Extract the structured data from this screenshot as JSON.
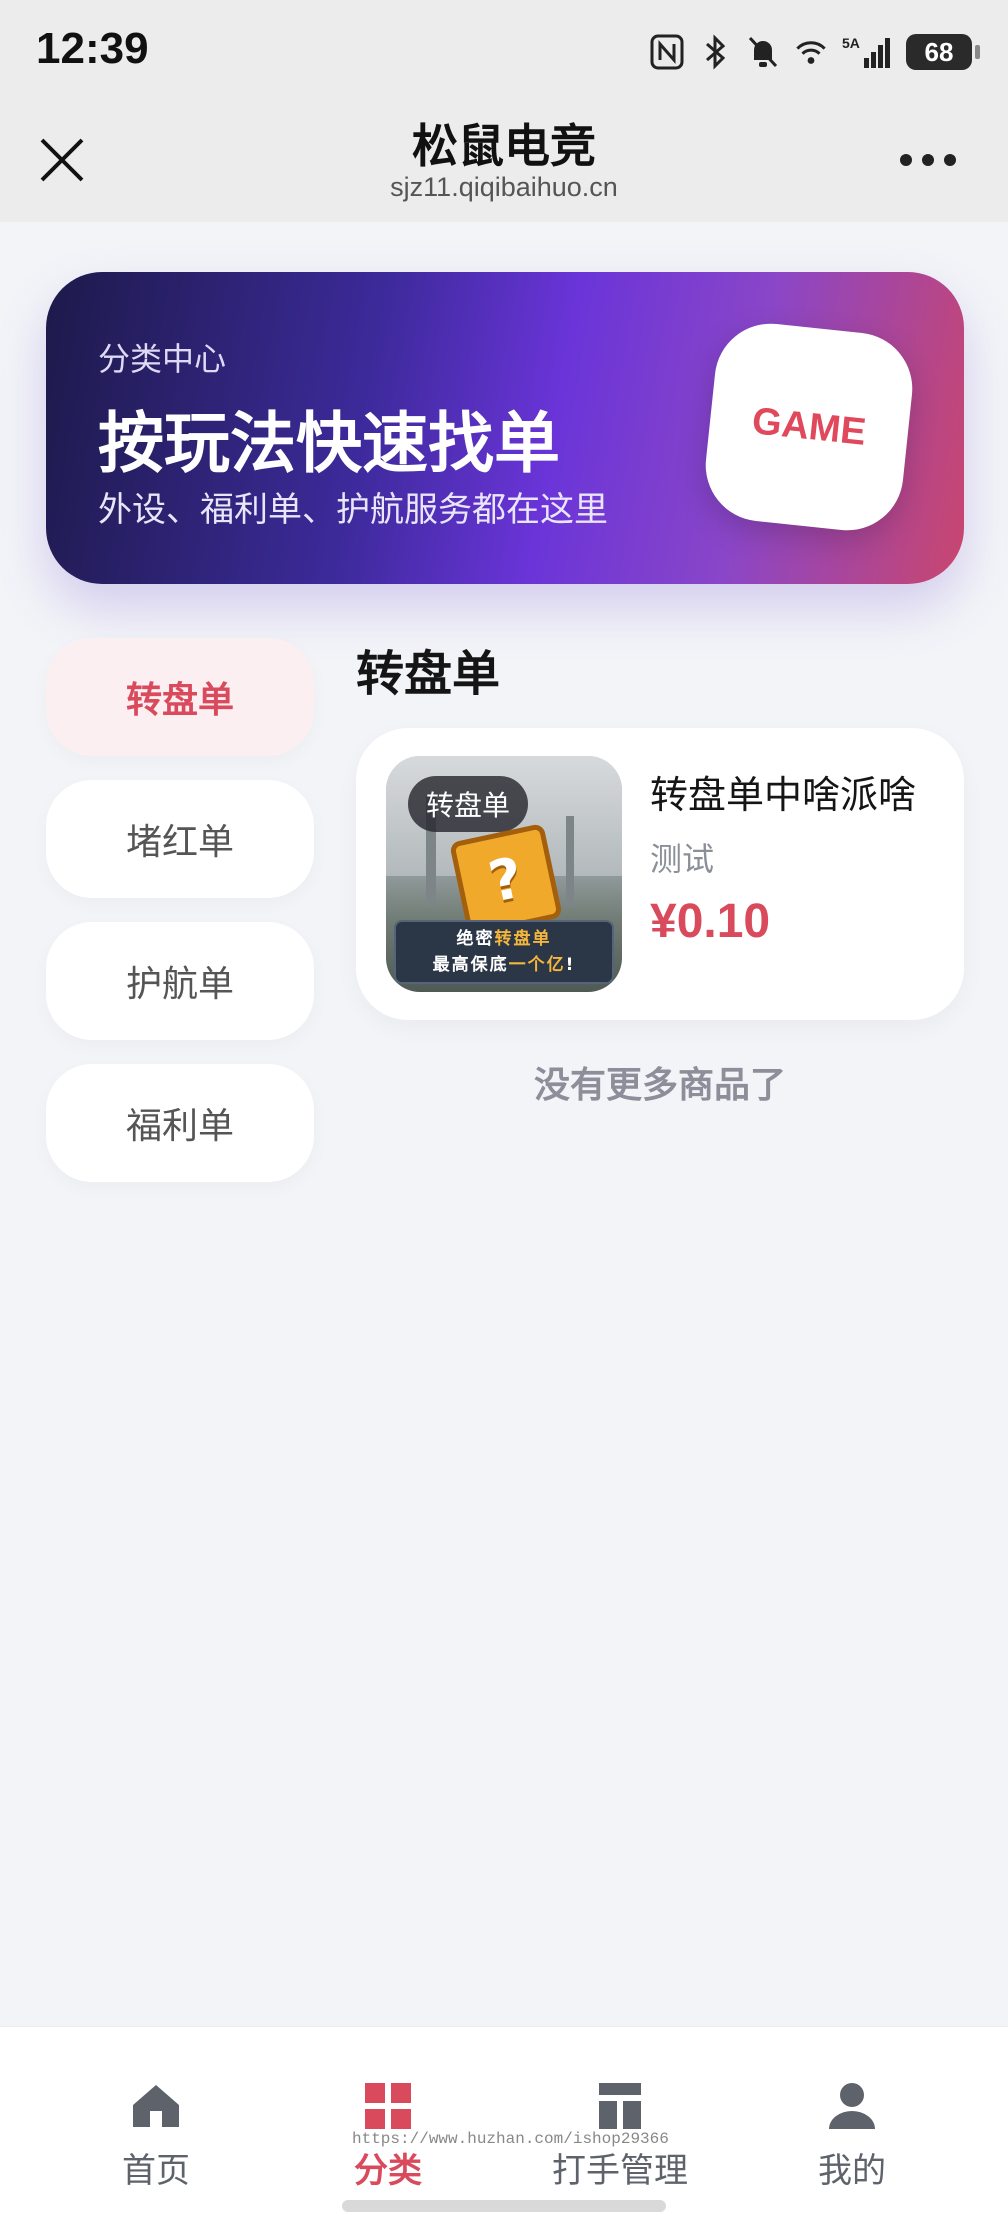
{
  "status_bar": {
    "time": "12:39",
    "battery": "68",
    "network": "5A"
  },
  "header": {
    "title": "松鼠电竞",
    "subtitle": "sjz11.qiqibaihuo.cn",
    "close_icon": "close-icon",
    "more_icon": "more-icon"
  },
  "banner": {
    "label": "分类中心",
    "title": "按玩法快速找单",
    "description": "外设、福利单、护航服务都在这里",
    "badge": "GAME"
  },
  "categories": [
    {
      "label": "转盘单",
      "active": true
    },
    {
      "label": "堵红单",
      "active": false
    },
    {
      "label": "护航单",
      "active": false
    },
    {
      "label": "福利单",
      "active": false
    }
  ],
  "section": {
    "title": "转盘单"
  },
  "products": [
    {
      "name": "转盘单中啥派啥",
      "subtitle": "测试",
      "price": "¥0.10",
      "thumb_tag": "转盘单",
      "thumb_line1_a": "绝密",
      "thumb_line1_b": "转盘单",
      "thumb_line2_a": "最高保底",
      "thumb_line2_b": "一个亿",
      "thumb_line2_c": "!"
    }
  ],
  "list_end": "没有更多商品了",
  "bottom_nav": [
    {
      "label": "首页",
      "icon": "home-icon",
      "active": false
    },
    {
      "label": "分类",
      "icon": "grid-icon",
      "active": true
    },
    {
      "label": "打手管理",
      "icon": "manage-icon",
      "active": false
    },
    {
      "label": "我的",
      "icon": "user-icon",
      "active": false
    }
  ],
  "watermark": "https://www.huzhan.com/ishop29366",
  "colors": {
    "accent": "#d94a5c",
    "banner_start": "#1d1a4a",
    "banner_end": "#c9466e"
  }
}
